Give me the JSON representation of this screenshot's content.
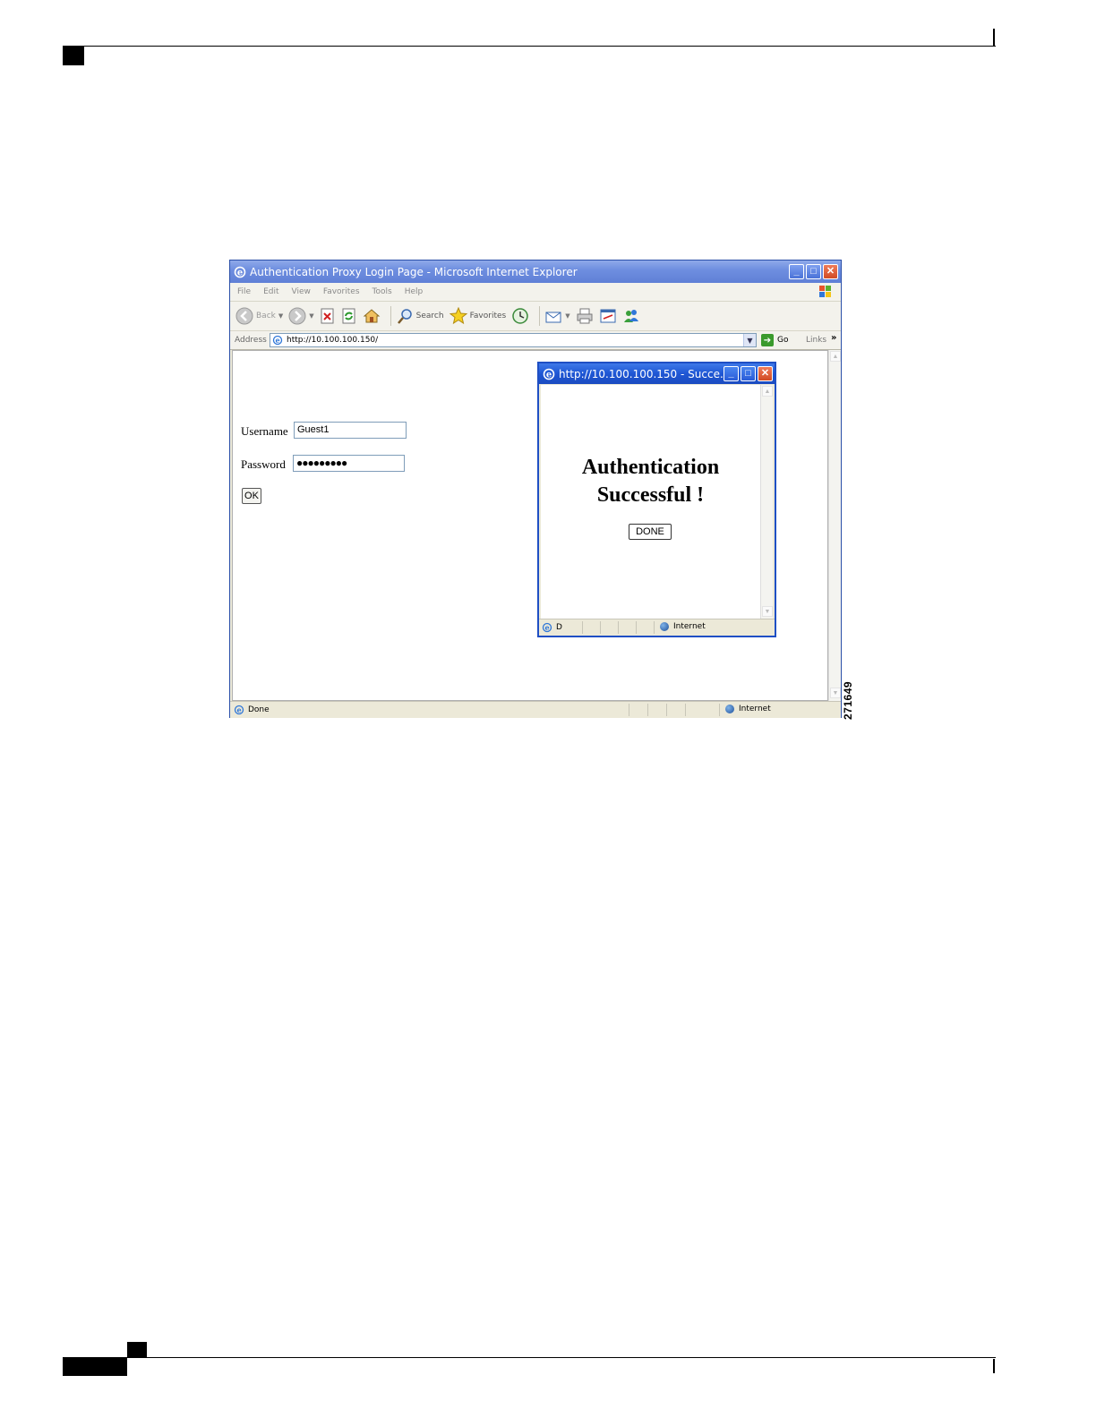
{
  "figure_number": "271649",
  "ie_window": {
    "title": "Authentication Proxy Login Page - Microsoft Internet Explorer",
    "menu": [
      "File",
      "Edit",
      "View",
      "Favorites",
      "Tools",
      "Help"
    ],
    "toolbar": {
      "back_label": "Back",
      "search_label": "Search",
      "favorites_label": "Favorites"
    },
    "address": {
      "label": "Address",
      "url": "http://10.100.100.150/",
      "go_label": "Go",
      "links_label": "Links",
      "chevron": "»"
    },
    "form": {
      "username_label": "Username",
      "username_value": "Guest1",
      "password_label": "Password",
      "password_dots": "●●●●●●●●●",
      "ok_label": "OK"
    },
    "status": {
      "text": "Done",
      "zone": "Internet"
    }
  },
  "popup": {
    "title": "http://10.100.100.150 - Succe...",
    "message_line1": "Authentication",
    "message_line2": "Successful !",
    "done_label": "DONE",
    "status_text": "D",
    "zone": "Internet"
  },
  "colors": {
    "title_active": "#1e56d4",
    "title_inactive": "#7f9be3",
    "close_button": "#d14b24"
  }
}
